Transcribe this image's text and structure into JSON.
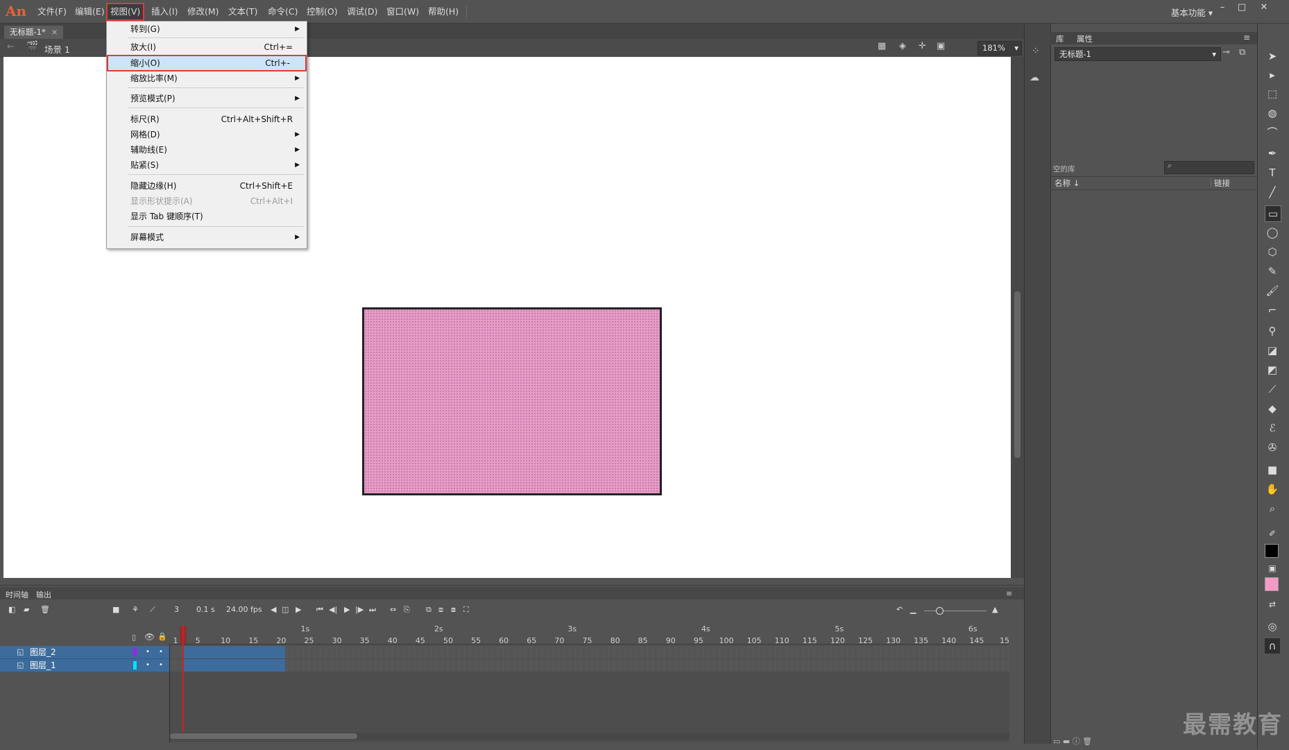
{
  "app": {
    "logo": "An",
    "menus": [
      "文件(F)",
      "编辑(E)",
      "视图(V)",
      "插入(I)",
      "修改(M)",
      "文本(T)",
      "命令(C)",
      "控制(O)",
      "调试(D)",
      "窗口(W)",
      "帮助(H)"
    ],
    "workspace": "基本功能"
  },
  "document": {
    "tab": "无标题-1*",
    "scene": "场景 1",
    "zoom": "181%"
  },
  "view_menu": {
    "items": [
      {
        "label": "转到(G)",
        "shortcut": "",
        "submenu": true
      },
      {
        "label": "放大(I)",
        "shortcut": "Ctrl+=",
        "submenu": false
      },
      {
        "label": "缩小(O)",
        "shortcut": "Ctrl+-",
        "submenu": false
      },
      {
        "label": "缩放比率(M)",
        "shortcut": "",
        "submenu": true
      },
      {
        "label": "预览模式(P)",
        "shortcut": "",
        "submenu": true
      },
      {
        "label": "标尺(R)",
        "shortcut": "Ctrl+Alt+Shift+R",
        "submenu": false
      },
      {
        "label": "网格(D)",
        "shortcut": "",
        "submenu": true
      },
      {
        "label": "辅助线(E)",
        "shortcut": "",
        "submenu": true
      },
      {
        "label": "贴紧(S)",
        "shortcut": "",
        "submenu": true
      },
      {
        "label": "隐藏边缘(H)",
        "shortcut": "Ctrl+Shift+E",
        "submenu": false
      },
      {
        "label": "显示形状提示(A)",
        "shortcut": "Ctrl+Alt+I",
        "submenu": false
      },
      {
        "label": "显示 Tab 键顺序(T)",
        "shortcut": "",
        "submenu": false
      },
      {
        "label": "屏幕模式",
        "shortcut": "",
        "submenu": true
      }
    ]
  },
  "library": {
    "tabs": [
      "库",
      "属性"
    ],
    "document_select": "无标题-1",
    "count_label": "空的库",
    "col_name": "名称 ↓",
    "col_link": "链接"
  },
  "timeline": {
    "tabs": [
      "时间轴",
      "输出"
    ],
    "current_frame": "3",
    "elapsed": "0.1 s",
    "fps": "24.00 fps",
    "seconds": [
      "1s",
      "2s",
      "3s",
      "4s",
      "5s",
      "6s"
    ],
    "ticks": [
      "1",
      "5",
      "10",
      "15",
      "20",
      "25",
      "30",
      "35",
      "40",
      "45",
      "50",
      "55",
      "60",
      "65",
      "70",
      "75",
      "80",
      "85",
      "90",
      "95",
      "100",
      "105",
      "110",
      "115",
      "120",
      "125",
      "130",
      "135",
      "140",
      "145",
      "15"
    ],
    "layers": [
      {
        "name": "图层_2",
        "color": "#a020f0"
      },
      {
        "name": "图层_1",
        "color": "#00e5ff"
      }
    ]
  },
  "watermark": "最需教育"
}
